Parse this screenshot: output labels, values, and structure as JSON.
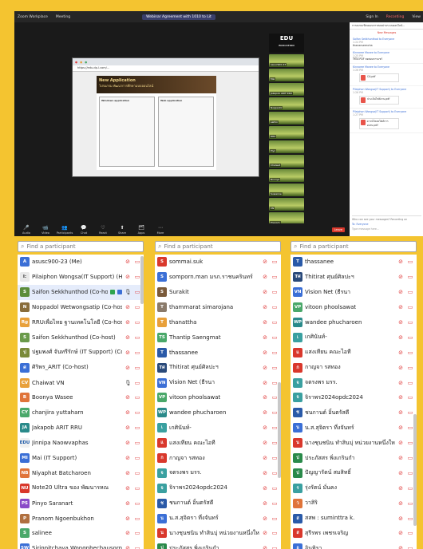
{
  "zoom": {
    "app": "Zoom Workplace",
    "meeting": "Meeting",
    "pill": "Webinar Agreement with 1010 to Lit",
    "sign_in": "Sign In",
    "recording": "Recording",
    "view": "View",
    "browser_url": "https://edu-dp-l.com/...",
    "page_title": "New Application",
    "page_sub": "โปรแกรม พัฒนาการศึกษาแบบออนไลน์",
    "win_app": "Windows application",
    "web_app": "Web application",
    "gallery_logo": "EDU",
    "gallery_logo_sub": "EDUCATION",
    "tile_labels": [
      "asusc900-23",
      "Mai",
      "Jakapob ARIT RRU",
      "Noppadol",
      "saifon",
      "RRU",
      "Piyo",
      "Chaiwat",
      "Boonya",
      "Suwanne",
      "VN",
      "Pranom",
      "Natthawat",
      "chanjira"
    ],
    "toolbar": [
      {
        "icon": "🎤",
        "label": "Audio"
      },
      {
        "icon": "📹",
        "label": "Video"
      },
      {
        "icon": "👥",
        "label": "Participants"
      },
      {
        "icon": "💬",
        "label": "Chat"
      },
      {
        "icon": "♡",
        "label": "React"
      },
      {
        "icon": "⬆",
        "label": "Share"
      },
      {
        "icon": "🗂",
        "label": "Apps"
      },
      {
        "icon": "⋯",
        "label": "More"
      }
    ],
    "participants_count": "32",
    "leave": "Leave"
  },
  "chat": {
    "header": "การอบรมเขียนแผนการสอนผ่านระบบออนไลน์...",
    "new_messages": "New Messages",
    "messages": [
      {
        "who": "Saifon Sekkhunthod to Everyone",
        "time": "1:24 PM",
        "text": "thananseencha"
      },
      {
        "who": "Kinnaree Manee to Everyone",
        "time": "1:25 PM",
        "text": "ใช้ได้ PDF ทดสอบการแชร์"
      },
      {
        "who": "Kinnaree Manee to Everyone",
        "time": "1:26 PM",
        "text": "CA.pdf"
      },
      {
        "who": "Pilaiphon Wongsa(IT Support) to Everyone",
        "time": "1:26 PM",
        "text": "ประเมินไฟล์งาน.pdf"
      },
      {
        "who": "Pilaiphon Wongsa(IT Support) to Everyone",
        "time": "1:27 PM",
        "text": "ดาวน์โหลดไฟล์การอบรม.pdf"
      }
    ],
    "who_can_see": "Who can see your messages? Recording on",
    "to_label": "To: Everyone",
    "placeholder": "Type message here..."
  },
  "search_placeholder": "Find a participant",
  "columns": [
    [
      {
        "name": "asusc900-23 (Me)",
        "av": "A",
        "color": "#3b6fd6",
        "mic": "off",
        "cam": "off"
      },
      {
        "name": "Pilaiphon Wongsa(IT Support) (Host)",
        "av": "I:",
        "color": "#e9e9e9",
        "mic": "off",
        "cam": "off",
        "avText": "#333"
      },
      {
        "name": "Saifon Sekkhunthod (Co-host)",
        "av": "S",
        "color": "#5b8c3a",
        "mic": "on",
        "cam": "off",
        "badge": true,
        "hl": true
      },
      {
        "name": "Noppadol Wetwongsatip (Co-host)",
        "av": "N",
        "color": "#8a6d3b",
        "mic": "off",
        "cam": "off"
      },
      {
        "name": "RRUเพื่อไทย ฐานเทคโนโลยี (Co-host)",
        "av": "Rg",
        "color": "#e8a03a",
        "mic": "off",
        "cam": "off"
      },
      {
        "name": "Saifon Sekkhunthod (Co-host)",
        "av": "S",
        "color": "#6a9a4a",
        "mic": "off",
        "cam": "off"
      },
      {
        "name": "ปฐมพงศ์ จันทรีรักษ์ (IT Support) (Co-host)",
        "av": "ป",
        "color": "#7a8a3a",
        "mic": "off",
        "cam": "off"
      },
      {
        "name": "ศิริพร_ARIT (Co-host)",
        "av": "ศ",
        "color": "#3b6fd6",
        "mic": "off",
        "cam": "off"
      },
      {
        "name": "Chaiwat VN",
        "av": "CV",
        "color": "#e8a03a",
        "mic": "on",
        "cam": "off"
      },
      {
        "name": "Boonya Wasee",
        "av": "B",
        "color": "#e0743a",
        "mic": "off",
        "cam": "off"
      },
      {
        "name": "chanjira yuttaharn",
        "av": "CY",
        "color": "#4aa86a",
        "mic": "off",
        "cam": "off"
      },
      {
        "name": "Jakapob ARIT RRU",
        "av": "JA",
        "color": "#2a8a8a",
        "mic": "off",
        "cam": "off"
      },
      {
        "name": "Jinnipa Naowvaphas",
        "av": "EDU",
        "color": "#f0f0f0",
        "mic": "off",
        "cam": "off",
        "avText": "#1e5aa8"
      },
      {
        "name": "Mai (IT Support)",
        "av": "MI",
        "color": "#3b6fd6",
        "mic": "off",
        "cam": "off"
      },
      {
        "name": "Niyaphat Batcharoen",
        "av": "NB",
        "color": "#e0743a",
        "mic": "off",
        "cam": "off"
      },
      {
        "name": "Note20 Ultra ของ พัฒนารหณ",
        "av": "NU",
        "color": "#d9382c",
        "mic": "off",
        "cam": "off"
      },
      {
        "name": "Pinyo Saranart",
        "av": "PS",
        "color": "#8a4ac8",
        "mic": "off",
        "cam": "off"
      },
      {
        "name": "Pranom Ngoenbukhon",
        "av": "P",
        "color": "#b07040",
        "mic": "off",
        "cam": "off"
      },
      {
        "name": "salinee",
        "av": "S",
        "color": "#4aa86a",
        "mic": "off",
        "cam": "off"
      },
      {
        "name": "Sirinpitchaya Wongphechausorn",
        "av": "SW",
        "color": "#3b6fd6",
        "mic": "off",
        "cam": "off"
      }
    ],
    [
      {
        "name": "sommai.suk",
        "av": "S",
        "color": "#d9382c",
        "mic": "off",
        "cam": "off"
      },
      {
        "name": "somporn.man มรภ.ราชนครินทร์",
        "av": "S",
        "color": "#3b6fd6",
        "mic": "off",
        "cam": "off"
      },
      {
        "name": "Surakit",
        "av": "S",
        "color": "#7a5a3a",
        "mic": "off",
        "cam": "off"
      },
      {
        "name": "thammarat simarojana",
        "av": "T",
        "color": "#8a7a6a",
        "mic": "off",
        "cam": "off"
      },
      {
        "name": "thanattha",
        "av": "T",
        "color": "#e8a03a",
        "mic": "off",
        "cam": "off"
      },
      {
        "name": "Thantip Saengmat",
        "av": "TS",
        "color": "#4aa86a",
        "mic": "off",
        "cam": "off"
      },
      {
        "name": "thassanee",
        "av": "T",
        "color": "#2a5aa8",
        "mic": "off",
        "cam": "off"
      },
      {
        "name": "Thitirat ศุนย์ศิลปะฯ",
        "av": "Tศ",
        "color": "#2a4a7a",
        "mic": "off",
        "cam": "off"
      },
      {
        "name": "Vision Net (ธีรนา",
        "av": "VN",
        "color": "#3b6fd6",
        "mic": "off",
        "cam": "off"
      },
      {
        "name": "vitoon phoolsawat",
        "av": "VP",
        "color": "#4aa86a",
        "mic": "off",
        "cam": "off"
      },
      {
        "name": "wandee phucharoen",
        "av": "WP",
        "color": "#2a8a8a",
        "mic": "off",
        "cam": "off"
      },
      {
        "name": "เกศินันท์-",
        "av": "เ",
        "color": "#3aa0a0",
        "mic": "off",
        "cam": "off"
      },
      {
        "name": "แสงเทียน คณะไอที",
        "av": "แ",
        "color": "#d9382c",
        "mic": "off",
        "cam": "off"
      },
      {
        "name": "กาญจา รสทอง",
        "av": "ก",
        "color": "#d9382c",
        "mic": "off",
        "cam": "off"
      },
      {
        "name": "จตรงพร มรร.",
        "av": "จ",
        "color": "#3aa0a0",
        "mic": "off",
        "cam": "off"
      },
      {
        "name": "จิราพร2024opdc2024",
        "av": "จ",
        "color": "#3aa0a0",
        "mic": "off",
        "cam": "off"
      },
      {
        "name": "ชนกานต์ อิ้นตรัสดี",
        "av": "ช",
        "color": "#2a5aa8",
        "mic": "off",
        "cam": "off"
      },
      {
        "name": "น.ส.สุจิตรา ที่งจันทร์",
        "av": "น",
        "color": "#3b6fd6",
        "mic": "off",
        "cam": "off"
      },
      {
        "name": "นางชุนชนิน ทำสินบุ่ หน่วยงานหนึ่งใหญ่",
        "av": "น",
        "color": "#d9382c",
        "mic": "off",
        "cam": "off"
      },
      {
        "name": "ประภัสสร พิ่งเกรินกำ",
        "av": "ป",
        "color": "#2a8a4a",
        "mic": "off",
        "cam": "off"
      }
    ],
    [
      {
        "name": "thassanee",
        "av": "T",
        "color": "#2a5aa8",
        "mic": "off",
        "cam": "off"
      },
      {
        "name": "Thitirat ศุนย์ศิลปะฯ",
        "av": "Tศ",
        "color": "#2a4a7a",
        "mic": "off",
        "cam": "off"
      },
      {
        "name": "Vision Net (ธีรนา",
        "av": "VN",
        "color": "#3b6fd6",
        "mic": "off",
        "cam": "off"
      },
      {
        "name": "vitoon phoolsawat",
        "av": "VP",
        "color": "#4aa86a",
        "mic": "off",
        "cam": "off"
      },
      {
        "name": "wandee phucharoen",
        "av": "WP",
        "color": "#2a8a8a",
        "mic": "off",
        "cam": "off"
      },
      {
        "name": "เกศินันท์-",
        "av": "เ",
        "color": "#3aa0a0",
        "mic": "off",
        "cam": "off"
      },
      {
        "name": "แสงเทียน คณะไอที",
        "av": "แ",
        "color": "#d9382c",
        "mic": "off",
        "cam": "off"
      },
      {
        "name": "กาญจา รสทอง",
        "av": "ก",
        "color": "#d9382c",
        "mic": "off",
        "cam": "off"
      },
      {
        "name": "จตรงพร มรร.",
        "av": "จ",
        "color": "#3aa0a0",
        "mic": "off",
        "cam": "off"
      },
      {
        "name": "จิราพร2024opdc2024",
        "av": "จ",
        "color": "#3aa0a0",
        "mic": "off",
        "cam": "off"
      },
      {
        "name": "ชนกานต์ อิ้นตรัสดี",
        "av": "ช",
        "color": "#2a5aa8",
        "mic": "off",
        "cam": "off"
      },
      {
        "name": "น.ส.สุจิตรา ที่งจันทร์",
        "av": "น",
        "color": "#3b6fd6",
        "mic": "off",
        "cam": "off"
      },
      {
        "name": "นางชุนชนิน ทำสินบุ่ หน่วยงานหนึ่งใหญ่",
        "av": "น",
        "color": "#d9382c",
        "mic": "off",
        "cam": "off"
      },
      {
        "name": "ประภัสสร พิ่งเกรินกำ",
        "av": "ป",
        "color": "#2a8a4a",
        "mic": "off",
        "cam": "off"
      },
      {
        "name": "ปัญญารัตน์ สมสิทธิ์",
        "av": "ป",
        "color": "#2a8a4a",
        "mic": "off",
        "cam": "off"
      },
      {
        "name": "รุ่งรัตน์ มั่นคง",
        "av": "ร",
        "color": "#3aa0a0",
        "mic": "off",
        "cam": "off"
      },
      {
        "name": "วาสิริ",
        "av": "ว",
        "color": "#e0743a",
        "mic": "off",
        "cam": "off"
      },
      {
        "name": "สสพ : suminttra k.",
        "av": "ส",
        "color": "#2a5aa8",
        "mic": "off",
        "cam": "off"
      },
      {
        "name": "สุรีรพร เพชรเจริญ",
        "av": "ส",
        "color": "#d9382c",
        "mic": "off",
        "cam": "off"
      },
      {
        "name": "อินทิรา",
        "av": "อ",
        "color": "#3b6fd6",
        "mic": "off",
        "cam": "off"
      }
    ]
  ]
}
